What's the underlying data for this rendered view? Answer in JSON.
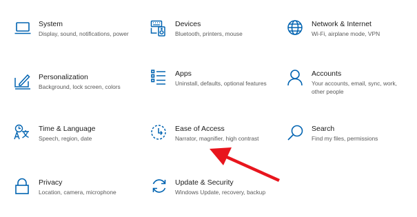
{
  "accent_color": "#0063b1",
  "annotation_arrow": {
    "color": "#e8151d",
    "icon": "red-arrow-pointer"
  },
  "categories": [
    {
      "icon": "laptop-icon",
      "title": "System",
      "description": "Display, sound, notifications, power"
    },
    {
      "icon": "keyboard-speaker-icon",
      "title": "Devices",
      "description": "Bluetooth, printers, mouse"
    },
    {
      "icon": "globe-icon",
      "title": "Network & Internet",
      "description": "Wi-Fi, airplane mode, VPN"
    },
    {
      "icon": "paint-pen-icon",
      "title": "Personalization",
      "description": "Background, lock screen, colors"
    },
    {
      "icon": "apps-list-icon",
      "title": "Apps",
      "description": "Uninstall, defaults, optional features"
    },
    {
      "icon": "person-icon",
      "title": "Accounts",
      "description": "Your accounts, email, sync, work, other people"
    },
    {
      "icon": "language-icon",
      "title": "Time & Language",
      "description": "Speech, region, date"
    },
    {
      "icon": "ease-of-access-icon",
      "title": "Ease of Access",
      "description": "Narrator, magnifier, high contrast"
    },
    {
      "icon": "search-icon",
      "title": "Search",
      "description": "Find my files, permissions"
    },
    {
      "icon": "lock-icon",
      "title": "Privacy",
      "description": "Location, camera, microphone"
    },
    {
      "icon": "update-sync-icon",
      "title": "Update & Security",
      "description": "Windows Update, recovery, backup"
    }
  ]
}
